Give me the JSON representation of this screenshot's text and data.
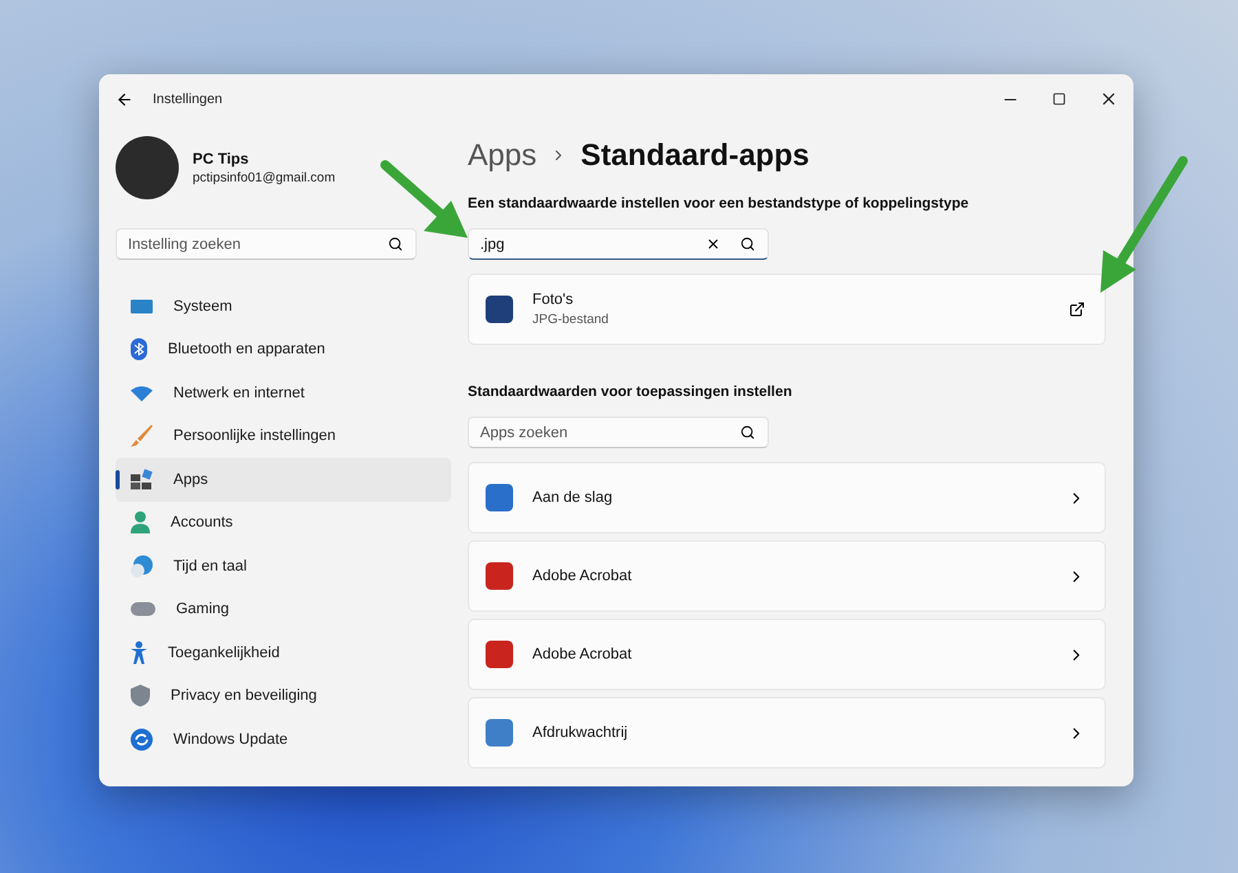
{
  "window": {
    "title": "Instellingen"
  },
  "user": {
    "name": "PC Tips",
    "email": "pctipsinfo01@gmail.com"
  },
  "sidebar": {
    "search": {
      "placeholder": "Instelling zoeken"
    },
    "items": [
      {
        "label": "Systeem",
        "selected": false
      },
      {
        "label": "Bluetooth en apparaten",
        "selected": false
      },
      {
        "label": "Netwerk en internet",
        "selected": false
      },
      {
        "label": "Persoonlijke instellingen",
        "selected": false
      },
      {
        "label": "Apps",
        "selected": true
      },
      {
        "label": "Accounts",
        "selected": false
      },
      {
        "label": "Tijd en taal",
        "selected": false
      },
      {
        "label": "Gaming",
        "selected": false
      },
      {
        "label": "Toegankelijkheid",
        "selected": false
      },
      {
        "label": "Privacy en beveiliging",
        "selected": false
      },
      {
        "label": "Windows Update",
        "selected": false
      }
    ]
  },
  "breadcrumb": {
    "parent": "Apps",
    "current": "Standaard-apps"
  },
  "filetype_section": {
    "heading": "Een standaardwaarde instellen voor een bestandstype of koppelingstype",
    "search": {
      "value": ".jpg"
    },
    "result": {
      "name": "Foto's",
      "type": "JPG-bestand"
    }
  },
  "apps_section": {
    "heading": "Standaardwaarden voor toepassingen instellen",
    "search": {
      "placeholder": "Apps zoeken"
    },
    "apps": [
      {
        "name": "Aan de slag"
      },
      {
        "name": "Adobe Acrobat"
      },
      {
        "name": "Adobe Acrobat"
      },
      {
        "name": "Afdrukwachtrij"
      }
    ]
  }
}
